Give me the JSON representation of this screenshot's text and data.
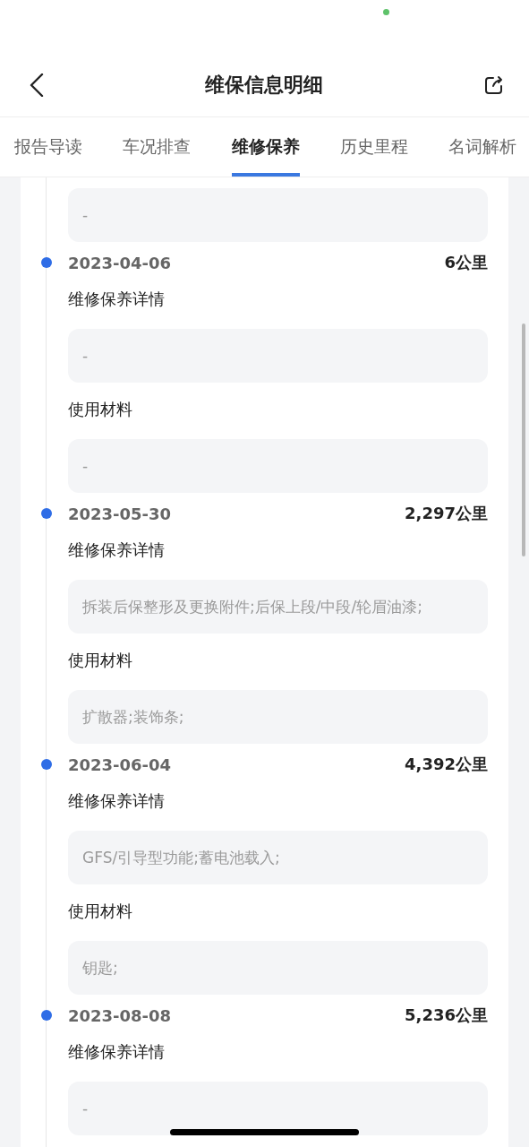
{
  "header": {
    "title": "维保信息明细"
  },
  "tabs": [
    {
      "label": "报告导读",
      "selected": false
    },
    {
      "label": "车况排查",
      "selected": false
    },
    {
      "label": "维修保养",
      "selected": true
    },
    {
      "label": "历史里程",
      "selected": false
    },
    {
      "label": "名词解析",
      "selected": false
    }
  ],
  "leading_box": {
    "value": "-"
  },
  "entries": [
    {
      "date": "2023-04-06",
      "mileage": "6公里",
      "sections": [
        {
          "label": "维修保养详情",
          "value": "-"
        },
        {
          "label": "使用材料",
          "value": "-"
        }
      ]
    },
    {
      "date": "2023-05-30",
      "mileage": "2,297公里",
      "sections": [
        {
          "label": "维修保养详情",
          "value": "拆装后保整形及更换附件;后保上段/中段/轮眉油漆;"
        },
        {
          "label": "使用材料",
          "value": "扩散器;装饰条;"
        }
      ]
    },
    {
      "date": "2023-06-04",
      "mileage": "4,392公里",
      "sections": [
        {
          "label": "维修保养详情",
          "value": "GFS/引导型功能;蓄电池载入;"
        },
        {
          "label": "使用材料",
          "value": "钥匙;"
        }
      ]
    },
    {
      "date": "2023-08-08",
      "mileage": "5,236公里",
      "sections": [
        {
          "label": "维修保养详情",
          "value": "-"
        }
      ]
    }
  ]
}
